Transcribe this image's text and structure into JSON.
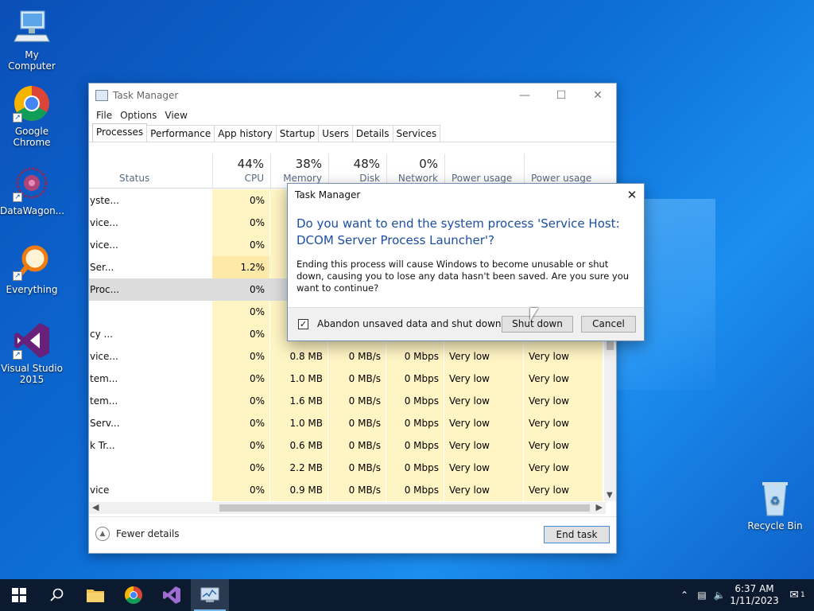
{
  "desktop": {
    "icons": [
      {
        "label": "My Computer"
      },
      {
        "label": "Google Chrome"
      },
      {
        "label": "DataWagon..."
      },
      {
        "label": "Everything"
      },
      {
        "label": "Visual Studio 2015"
      },
      {
        "label": "Recycle Bin"
      }
    ]
  },
  "taskmanager": {
    "title": "Task Manager",
    "menu": [
      "File",
      "Options",
      "View"
    ],
    "tabs": [
      "Processes",
      "Performance",
      "App history",
      "Startup",
      "Users",
      "Details",
      "Services"
    ],
    "columns": {
      "status": "Status",
      "cpu": {
        "pct": "44%",
        "label": "CPU"
      },
      "memory": {
        "pct": "38%",
        "label": "Memory"
      },
      "disk": {
        "pct": "48%",
        "label": "Disk"
      },
      "network": {
        "pct": "0%",
        "label": "Network"
      },
      "power": "Power usage",
      "power_trend": "Power usage t..."
    },
    "rows": [
      {
        "name": "yste...",
        "cpu": "0%",
        "mem": "",
        "disk": "",
        "net": "",
        "pu": "",
        "put": ""
      },
      {
        "name": "vice...",
        "cpu": "0%",
        "mem": "",
        "disk": "",
        "net": "",
        "pu": "",
        "put": ""
      },
      {
        "name": "vice...",
        "cpu": "0%",
        "mem": "",
        "disk": "",
        "net": "",
        "pu": "",
        "put": ""
      },
      {
        "name": "Ser...",
        "cpu": "1.2%",
        "mem": "",
        "disk": "",
        "net": "",
        "pu": "",
        "put": ""
      },
      {
        "name": "Proc...",
        "cpu": "0%",
        "mem": "",
        "disk": "",
        "net": "",
        "pu": "",
        "put": ""
      },
      {
        "name": "",
        "cpu": "0%",
        "mem": "",
        "disk": "",
        "net": "",
        "pu": "",
        "put": ""
      },
      {
        "name": "cy ...",
        "cpu": "0%",
        "mem": "",
        "disk": "",
        "net": "",
        "pu": "",
        "put": ""
      },
      {
        "name": "vice...",
        "cpu": "0%",
        "mem": "0.8 MB",
        "disk": "0 MB/s",
        "net": "0 Mbps",
        "pu": "Very low",
        "put": "Very low"
      },
      {
        "name": "tem...",
        "cpu": "0%",
        "mem": "1.0 MB",
        "disk": "0 MB/s",
        "net": "0 Mbps",
        "pu": "Very low",
        "put": "Very low"
      },
      {
        "name": "tem...",
        "cpu": "0%",
        "mem": "1.6 MB",
        "disk": "0 MB/s",
        "net": "0 Mbps",
        "pu": "Very low",
        "put": "Very low"
      },
      {
        "name": "Serv...",
        "cpu": "0%",
        "mem": "1.0 MB",
        "disk": "0 MB/s",
        "net": "0 Mbps",
        "pu": "Very low",
        "put": "Very low"
      },
      {
        "name": "k Tr...",
        "cpu": "0%",
        "mem": "0.6 MB",
        "disk": "0 MB/s",
        "net": "0 Mbps",
        "pu": "Very low",
        "put": "Very low"
      },
      {
        "name": "",
        "cpu": "0%",
        "mem": "2.2 MB",
        "disk": "0 MB/s",
        "net": "0 Mbps",
        "pu": "Very low",
        "put": "Very low"
      },
      {
        "name": "vice",
        "cpu": "0%",
        "mem": "0.9 MB",
        "disk": "0 MB/s",
        "net": "0 Mbps",
        "pu": "Very low",
        "put": "Very low"
      }
    ],
    "fewer_details": "Fewer details",
    "end_task": "End task"
  },
  "dialog": {
    "title": "Task Manager",
    "heading": "Do you want to end the system process 'Service Host: DCOM Server Process Launcher'?",
    "body": "Ending this process will cause Windows to become unusable or shut down, causing you to lose any data hasn't been saved. Are you sure you want to continue?",
    "checkbox_label": "Abandon unsaved data and shut down.",
    "checkbox_checked": true,
    "shutdown_label": "Shut down",
    "cancel_label": "Cancel"
  },
  "taskbar": {
    "time": "6:37 AM",
    "date": "1/11/2023",
    "notification_count": "1"
  },
  "colors": {
    "heading_blue": "#1d4fa0",
    "heat_yellow": "#fff4c4",
    "taskbar": "#0b1a2e"
  }
}
